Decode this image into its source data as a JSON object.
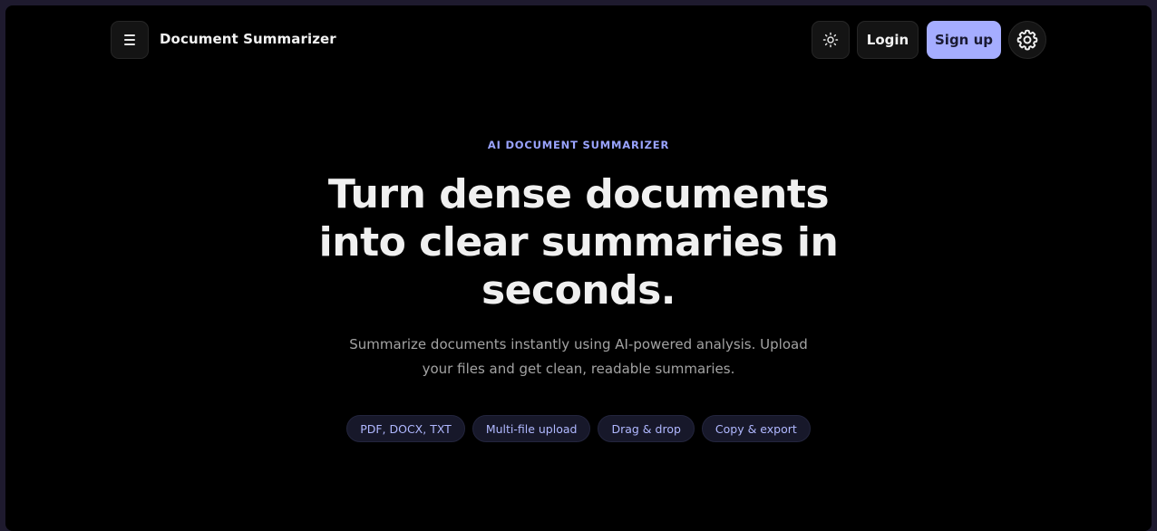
{
  "header": {
    "brand": "Document Summarizer",
    "login_label": "Login",
    "signup_label": "Sign up",
    "menu_icon": "hamburger-icon",
    "theme_icon": "sun-icon",
    "settings_icon": "gear-icon"
  },
  "hero": {
    "eyebrow": "AI DOCUMENT SUMMARIZER",
    "headline": "Turn dense documents into clear summaries in seconds.",
    "subhead": "Summarize documents instantly using AI-powered analysis. Upload your files and get clean, readable summaries.",
    "chips": [
      "PDF, DOCX, TXT",
      "Multi-file upload",
      "Drag & drop",
      "Copy & export"
    ]
  },
  "colors": {
    "accent": "#a5adff",
    "background": "#000000",
    "chip_text": "#b0b8ff"
  }
}
